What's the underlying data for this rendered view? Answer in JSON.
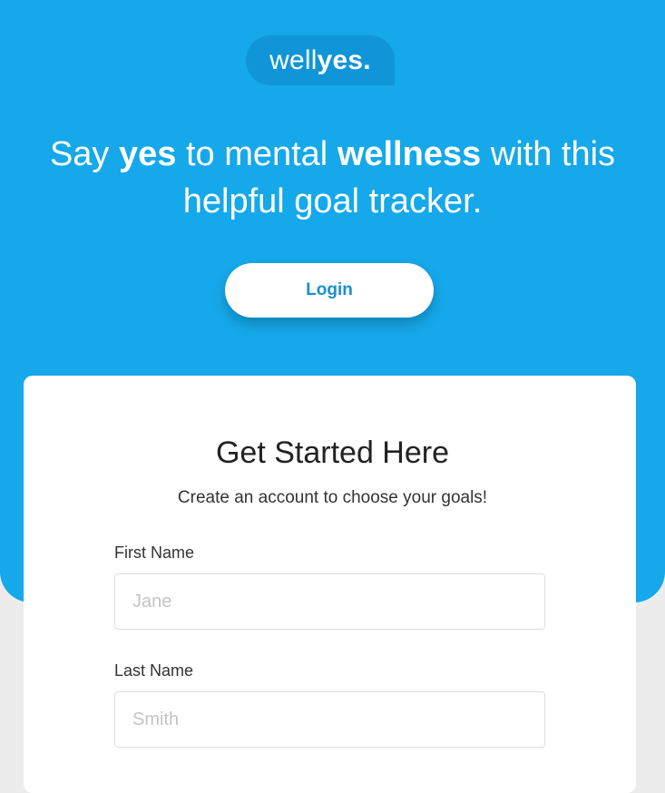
{
  "logo": {
    "light": "well",
    "bold": "yes."
  },
  "hero": {
    "say": "Say ",
    "yes": "yes",
    "to_mental": " to mental ",
    "wellness": "wellness",
    "rest": " with this helpful goal tracker."
  },
  "login_label": "Login",
  "form": {
    "title": "Get Started Here",
    "subtitle": "Create an account to choose your goals!",
    "first_name": {
      "label": "First Name",
      "placeholder": "Jane"
    },
    "last_name": {
      "label": "Last Name",
      "placeholder": "Smith"
    }
  },
  "colors": {
    "brand_blue": "#15a8ea",
    "logo_bg": "#0f95d8",
    "login_text": "#1a8fd0"
  }
}
